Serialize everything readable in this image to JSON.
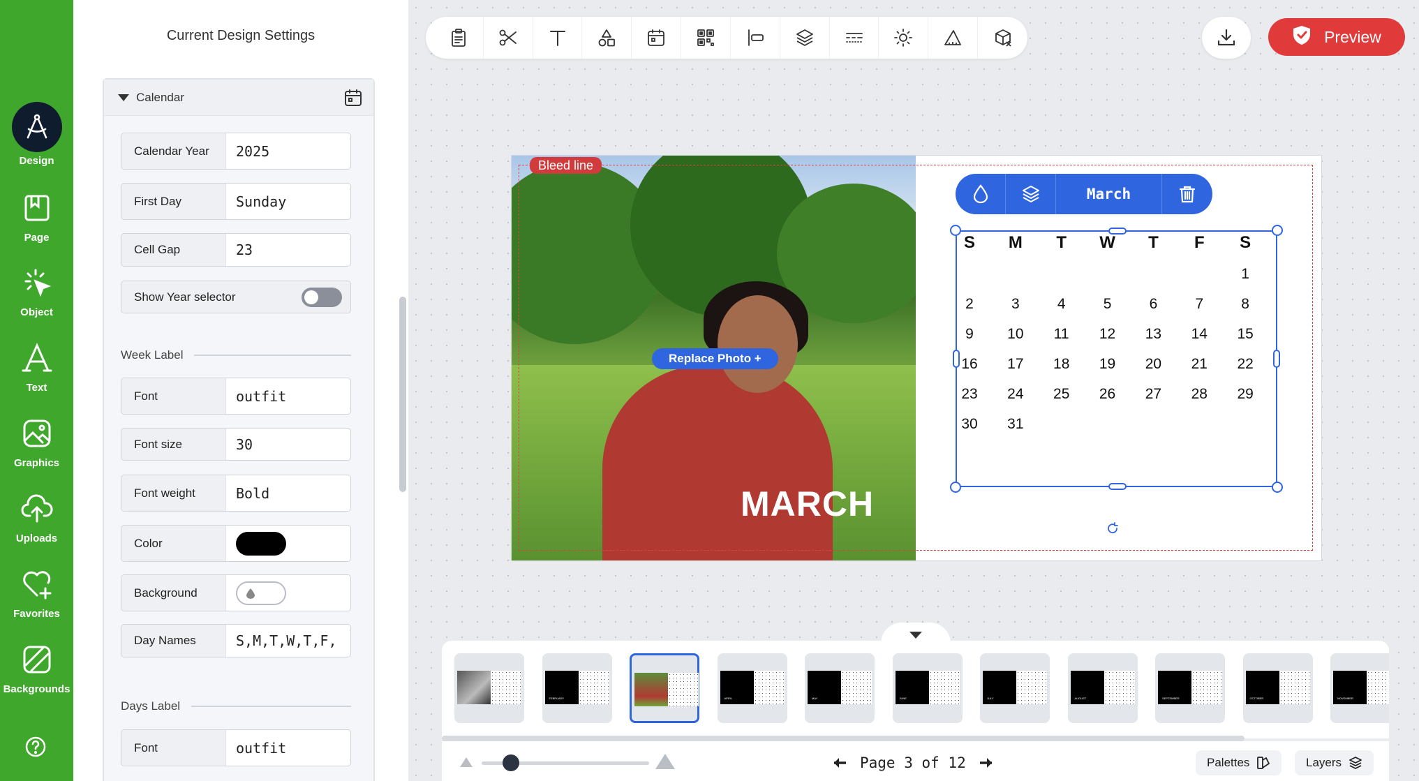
{
  "rail": {
    "items": [
      {
        "label": "Design",
        "icon": "compass-icon",
        "active": true
      },
      {
        "label": "Page",
        "icon": "page-icon"
      },
      {
        "label": "Object",
        "icon": "cursor-click-icon"
      },
      {
        "label": "Text",
        "icon": "text-a-icon"
      },
      {
        "label": "Graphics",
        "icon": "image-icon"
      },
      {
        "label": "Uploads",
        "icon": "cloud-upload-icon"
      },
      {
        "label": "Favorites",
        "icon": "heart-plus-icon"
      },
      {
        "label": "Backgrounds",
        "icon": "background-icon"
      }
    ],
    "help_icon": "help-icon",
    "color": "#3fa82c"
  },
  "panel": {
    "title": "Current Design Settings",
    "section": {
      "label": "Calendar",
      "icon": "calendar-icon"
    },
    "fields": {
      "calendar_year": {
        "label": "Calendar Year",
        "value": "2025"
      },
      "first_day": {
        "label": "First Day",
        "value": "Sunday"
      },
      "cell_gap": {
        "label": "Cell Gap",
        "value": "23"
      },
      "show_year_selector": {
        "label": "Show Year selector",
        "on": false
      }
    },
    "week_label": {
      "heading": "Week Label",
      "font": {
        "label": "Font",
        "value": "outfit"
      },
      "font_size": {
        "label": "Font size",
        "value": "30"
      },
      "font_weight": {
        "label": "Font weight",
        "value": "Bold"
      },
      "color": {
        "label": "Color",
        "value": "#000000"
      },
      "background": {
        "label": "Background"
      },
      "day_names": {
        "label": "Day Names",
        "value": "S,M,T,W,T,F,"
      }
    },
    "days_label": {
      "heading": "Days Label",
      "font": {
        "label": "Font",
        "value": "outfit"
      }
    }
  },
  "toolbar": {
    "tools": [
      "clipboard-icon",
      "scissors-icon",
      "text-icon",
      "shapes-icon",
      "calendar-icon",
      "qr-code-icon",
      "align-left-icon",
      "layers-icon",
      "line-style-icon",
      "brightness-icon",
      "triangle-ruler-icon",
      "box-icon"
    ],
    "download_icon": "download-icon",
    "preview_label": "Preview",
    "preview_color": "#e03a3a"
  },
  "design": {
    "bleed_label": "Bleed line",
    "replace_photo_label": "Replace Photo +",
    "month_title": "MARCH",
    "calendar_toolbar": {
      "month_label": "March"
    },
    "day_headers": [
      "S",
      "M",
      "T",
      "W",
      "T",
      "F",
      "S"
    ],
    "weeks": [
      [
        "",
        "",
        "",
        "",
        "",
        "",
        "1"
      ],
      [
        "2",
        "3",
        "4",
        "5",
        "6",
        "7",
        "8"
      ],
      [
        "9",
        "10",
        "11",
        "12",
        "13",
        "14",
        "15"
      ],
      [
        "16",
        "17",
        "18",
        "19",
        "20",
        "21",
        "22"
      ],
      [
        "23",
        "24",
        "25",
        "26",
        "27",
        "28",
        "29"
      ],
      [
        "30",
        "31",
        "",
        "",
        "",
        "",
        ""
      ]
    ],
    "accent": "#2f66e0"
  },
  "thumbnails": [
    {
      "name": "january",
      "label": ""
    },
    {
      "name": "february",
      "label": "FEBRUARY"
    },
    {
      "name": "march",
      "label": "",
      "active": true
    },
    {
      "name": "april",
      "label": "APRIL"
    },
    {
      "name": "may",
      "label": "MAY"
    },
    {
      "name": "june",
      "label": "JUNE"
    },
    {
      "name": "july",
      "label": "JULY"
    },
    {
      "name": "august",
      "label": "AUGUST"
    },
    {
      "name": "september",
      "label": "SEPTEMBER"
    },
    {
      "name": "october",
      "label": "OCTOBER"
    },
    {
      "name": "november",
      "label": "NOVEMBER"
    }
  ],
  "bottom": {
    "page_text": "Page 3 of 12",
    "current_page": 3,
    "total_pages": 12,
    "palettes_label": "Palettes",
    "layers_label": "Layers"
  }
}
